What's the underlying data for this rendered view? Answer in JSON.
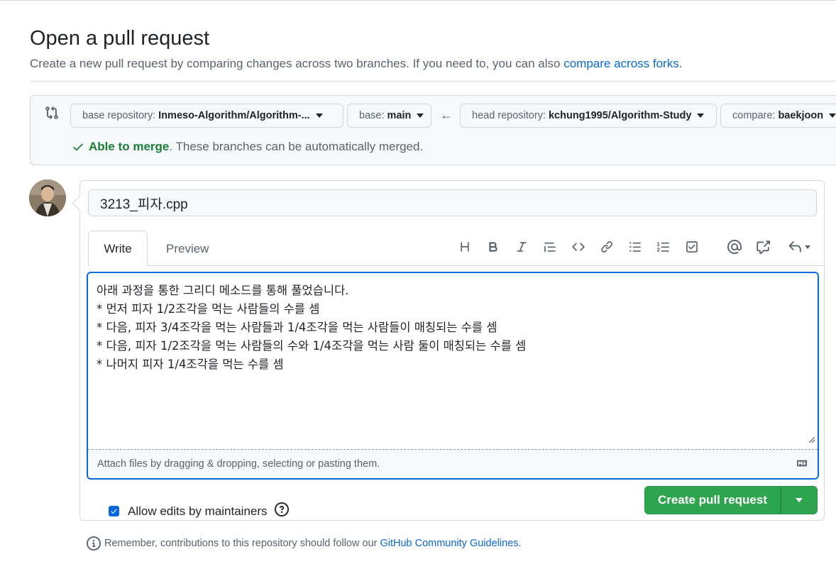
{
  "page": {
    "title": "Open a pull request",
    "subtitle_prefix": "Create a new pull request by comparing changes across two branches. If you need to, you can also ",
    "subtitle_link": "compare across forks",
    "subtitle_suffix": "."
  },
  "range": {
    "base_repo_label": "base repository:",
    "base_repo_value": "Inmeso-Algorithm/Algorithm-...",
    "base_label": "base:",
    "base_value": "main",
    "head_repo_label": "head repository:",
    "head_repo_value": "kchung1995/Algorithm-Study",
    "compare_label": "compare:",
    "compare_value": "baekjoon",
    "merge_ok": "Able to merge",
    "merge_msg": ". These branches can be automatically merged."
  },
  "form": {
    "title_value": "3213_피자.cpp",
    "tabs": [
      "Write",
      "Preview"
    ],
    "body_lines": [
      "아래 과정을 통한 그리디 메소드를 통해 풀었습니다.",
      "* 먼저 피자 1/2조각을 먹는 사람들의 수를 셈",
      "* 다음, 피자 3/4조각을 먹는 사람들과 1/4조각을 먹는 사람들이 매칭되는 수를 셈",
      "* 다음, 피자 1/2조각을 먹는 사람들의 수와 1/4조각을 먹는 사람 둘이 매칭되는 수를 셈",
      "* 나머지 피자 1/4조각을 먹는 수를 셈"
    ],
    "attach_text": "Attach files by dragging & dropping, selecting or pasting them.",
    "allow_edits_label": "Allow edits by maintainers",
    "allow_edits_checked": true,
    "create_button": "Create pull request"
  },
  "toolbar": {
    "icons": [
      "heading-icon",
      "bold-icon",
      "italic-icon",
      "quote-icon",
      "code-icon",
      "link-icon",
      "unordered-list-icon",
      "ordered-list-icon",
      "task-list-icon",
      "mention-icon",
      "cross-reference-icon",
      "reply-icon"
    ]
  },
  "footer": {
    "remember_text": "Remember, contributions to this repository should follow our",
    "guidelines_link": "GitHub Community Guidelines",
    "suffix": "."
  },
  "colors": {
    "accent": "#0969da",
    "success": "#1a7f37",
    "button_green": "#2da44e"
  }
}
